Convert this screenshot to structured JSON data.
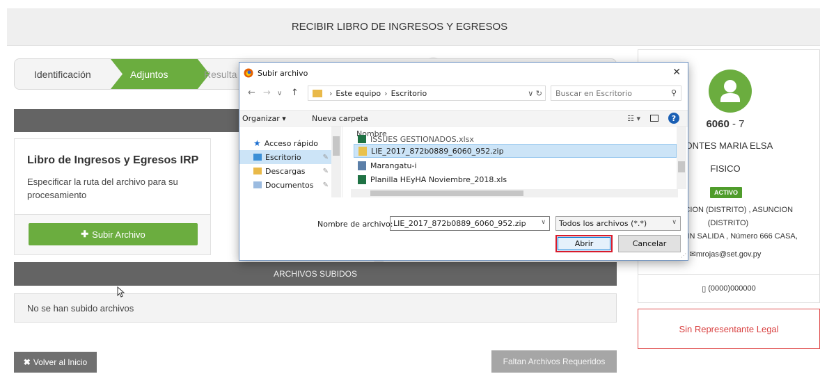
{
  "header": {
    "title": "RECIBIR LIBRO DE INGRESOS Y EGRESOS"
  },
  "stepper": {
    "steps": [
      "Identificación",
      "Adjuntos",
      "Resulta"
    ]
  },
  "card": {
    "title": "Libro de Ingresos y Egresos IRP",
    "description": "Especificar la ruta del archivo para su procesamiento",
    "upload_button": "Subir Archivo"
  },
  "uploaded": {
    "title": "ARCHIVOS SUBIDOS",
    "empty_text": "No se han subido archivos"
  },
  "footer": {
    "back_button": "Volver al Inicio",
    "missing_button": "Faltan Archivos Requeridos"
  },
  "profile": {
    "ruc": "6060",
    "dv": "- 7",
    "name": "MONTES MARIA ELSA",
    "type": "FISICO",
    "status": "ACTIVO",
    "address_line1": "ASUNCION (DISTRITO) , ASUNCION",
    "address_line2": "(DISTRITO)",
    "street": "ALLE SIN SALIDA , Número 666 CASA,",
    "email": "mrojas@set.gov.py",
    "phone": "(0000)000000",
    "legal": "Sin Representante Legal"
  },
  "dialog": {
    "title": "Subir archivo",
    "breadcrumb": [
      "Este equipo",
      "Escritorio"
    ],
    "search_placeholder": "Buscar en Escritorio",
    "toolbar": {
      "organize": "Organizar ▾",
      "new_folder": "Nueva carpeta"
    },
    "nav": [
      "Acceso rápido",
      "Escritorio",
      "Descargas",
      "Documentos"
    ],
    "column_name": "Nombre",
    "files": [
      "ISSUES GESTIONADOS.xlsx",
      "LIE_2017_872b0889_6060_952.zip",
      "Marangatu-i",
      "Planilla HEyHA Noviembre_2018.xls"
    ],
    "filename_label": "Nombre de archivo:",
    "filename_value": "LIE_2017_872b0889_6060_952.zip",
    "filetype": "Todos los archivos (*.*)",
    "open_button": "Abrir",
    "cancel_button": "Cancelar"
  },
  "colors": {
    "green": "#6bad3f",
    "dark_bar": "#646464",
    "red": "#d94040",
    "selection": "#cce4f7"
  }
}
